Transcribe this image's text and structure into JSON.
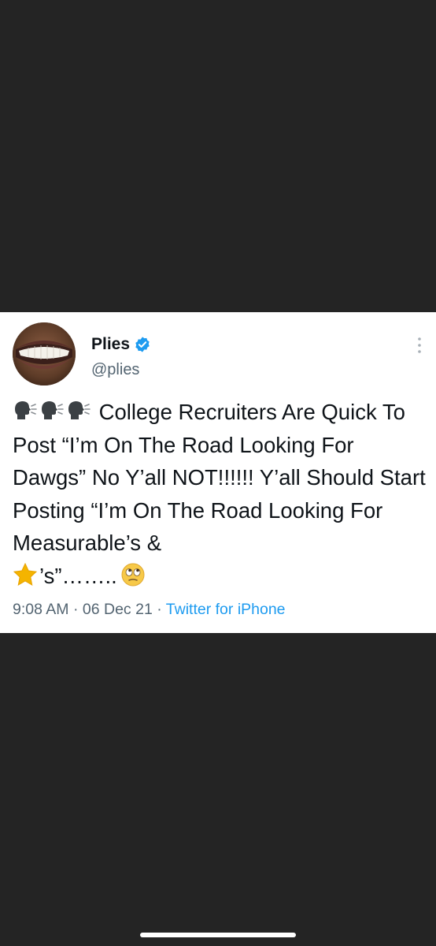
{
  "tweet": {
    "display_name": "Plies",
    "handle": "@plies",
    "body_parts": [
      " College Recruiters Are Quick To Post “I’m On The Road Looking For Dawgs” No Y’all NOT!!!!!! Y’all Should Start Posting “I’m On The Road Looking For Measurable’s & ",
      "’s”……..",
      ""
    ],
    "icons": {
      "speaking_head": "speaking-head-emoji",
      "star": "star-emoji",
      "eye_roll": "face-with-rolling-eyes-emoji",
      "verified": "verified-badge-icon",
      "more": "more-vertical-icon"
    },
    "time": "9:08 AM",
    "separator": "·",
    "date": "06 Dec 21",
    "source": "Twitter for iPhone"
  },
  "colors": {
    "background": "#242424",
    "card": "#ffffff",
    "text_primary": "#0f1419",
    "text_secondary": "#536471",
    "link": "#1d9bf0"
  }
}
